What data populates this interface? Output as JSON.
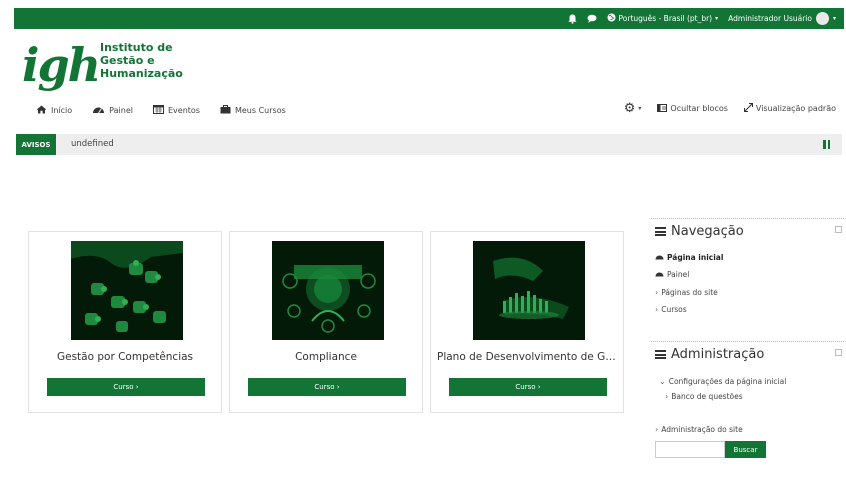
{
  "topbar": {
    "language": "Português - Brasil (pt_br)",
    "user": "Administrador Usuário"
  },
  "logo": {
    "mark": "igh",
    "name_line1": "Instituto de",
    "name_line2": "Gestão e",
    "name_line3": "Humanização"
  },
  "nav": {
    "items": [
      "Início",
      "Painel",
      "Eventos",
      "Meus Cursos"
    ],
    "hide_blocks": "Ocultar blocos",
    "default_view": "Visualização padrão"
  },
  "notice": {
    "tag": "AVISOS",
    "text": "undefined"
  },
  "courses": [
    {
      "title": "Gestão por Competências",
      "button": "Curso ›"
    },
    {
      "title": "Compliance",
      "button": "Curso ›"
    },
    {
      "title": "Plano de Desenvolvimento de Gestores",
      "button": "Curso ›"
    }
  ],
  "navigation": {
    "title": "Navegação",
    "items": [
      "Página inicial",
      "Painel",
      "Páginas do site",
      "Cursos"
    ]
  },
  "administration": {
    "title": "Administração",
    "items": [
      "Configurações da página inicial",
      "Banco de questões",
      "Administração do site"
    ]
  },
  "search": {
    "button": "Buscar",
    "value": ""
  },
  "colors": {
    "brand": "#127536",
    "notice_bg": "#eeeeee",
    "image_bg": "#031a09"
  },
  "icons": [
    "bell-icon",
    "chat-icon",
    "globe-icon",
    "home-icon",
    "dashboard-icon",
    "calendar-icon",
    "briefcase-icon",
    "gear-icon",
    "hide-blocks-icon",
    "expand-icon",
    "pause-icon",
    "menu-icon"
  ]
}
